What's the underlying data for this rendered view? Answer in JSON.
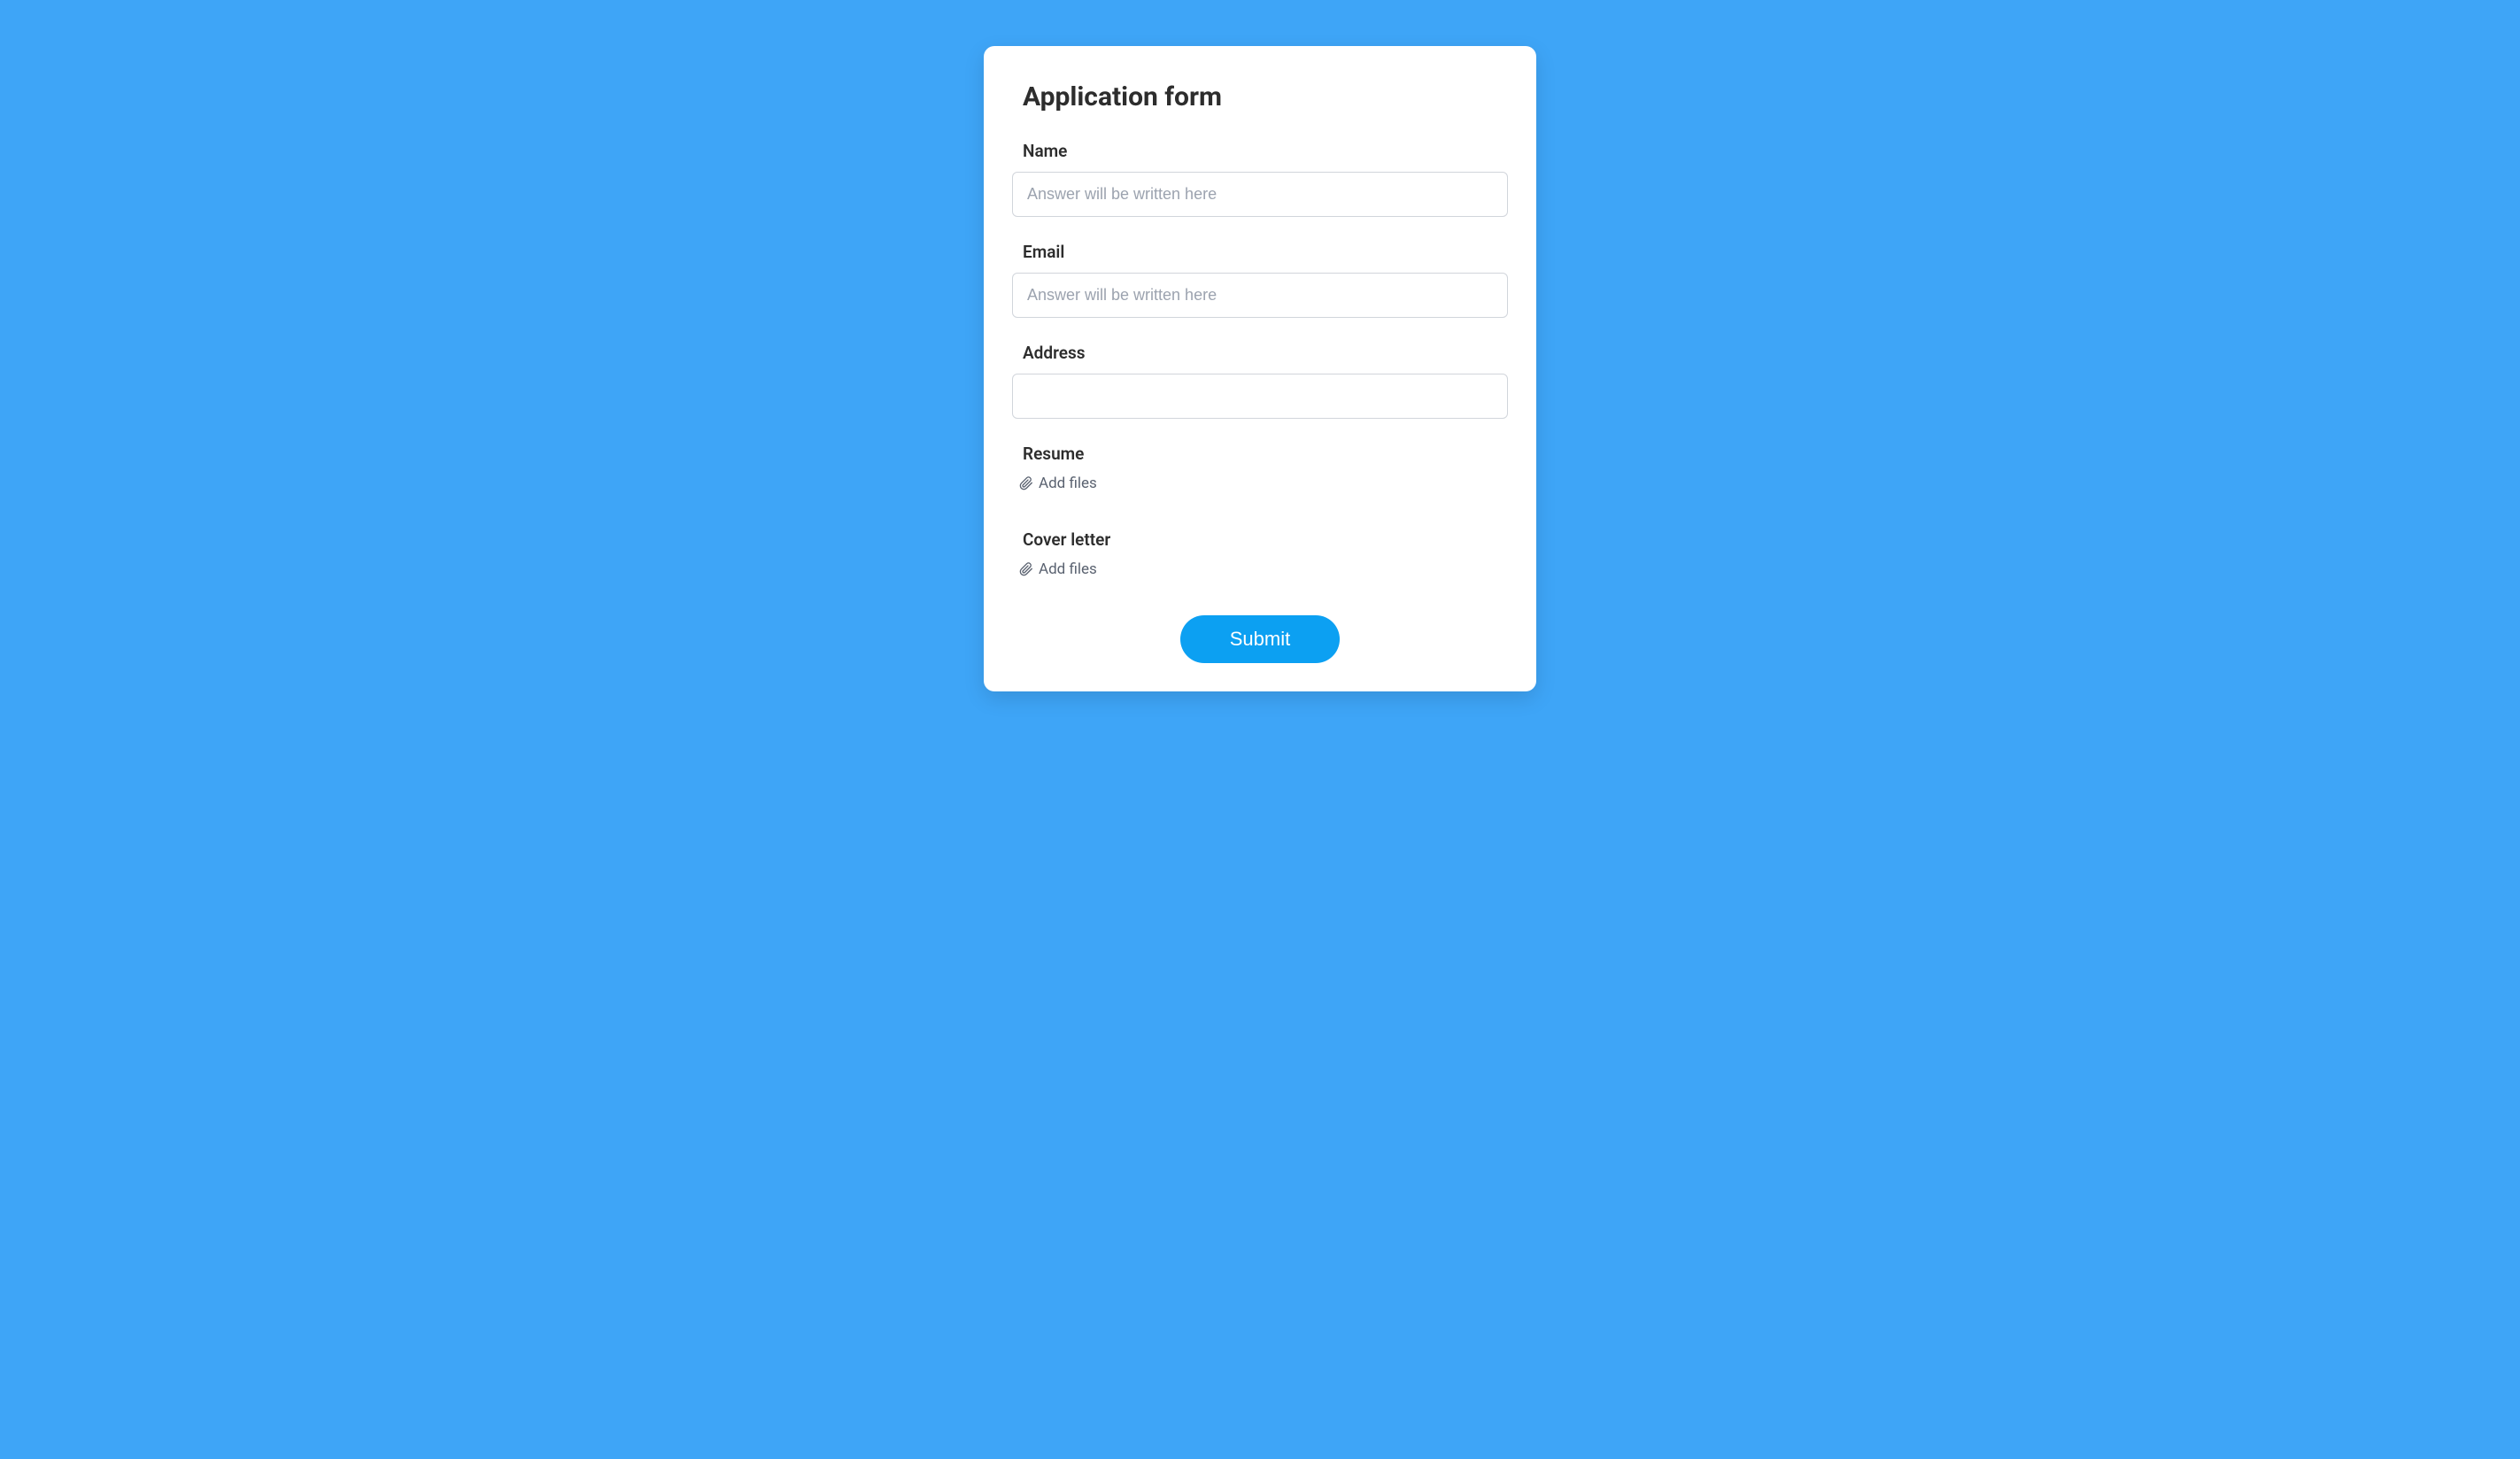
{
  "form": {
    "title": "Application form",
    "fields": {
      "name": {
        "label": "Name",
        "placeholder": "Answer will be written here",
        "value": ""
      },
      "email": {
        "label": "Email",
        "placeholder": "Answer will be written here",
        "value": ""
      },
      "address": {
        "label": "Address",
        "placeholder": "",
        "value": ""
      },
      "resume": {
        "label": "Resume",
        "action": "Add files"
      },
      "cover_letter": {
        "label": "Cover letter",
        "action": "Add files"
      }
    },
    "submit_label": "Submit"
  }
}
